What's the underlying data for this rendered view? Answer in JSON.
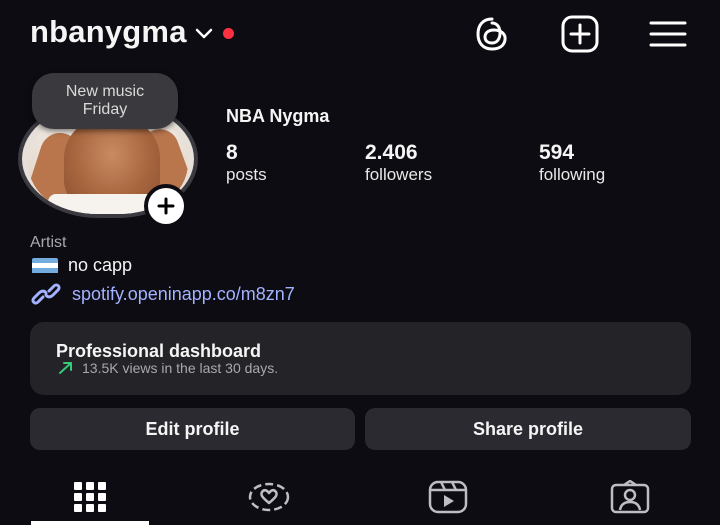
{
  "header": {
    "username": "nbanygma",
    "has_notification_dot": true,
    "icons": [
      "threads-icon",
      "create-post-icon",
      "menu-icon"
    ]
  },
  "note": {
    "line1": "New music",
    "line2": "Friday"
  },
  "profile": {
    "display_name": "NBA Nygma",
    "stats": [
      {
        "value": "8",
        "label": "posts"
      },
      {
        "value": "2.406",
        "label": "followers"
      },
      {
        "value": "594",
        "label": "following"
      }
    ],
    "category": "Artist",
    "bio": "no capp",
    "flag": "argentina-flag-icon",
    "link": "spotify.openinapp.co/m8zn7"
  },
  "dashboard": {
    "title": "Professional dashboard",
    "subtitle": "13.5K views in the last 30 days."
  },
  "actions": {
    "edit": "Edit profile",
    "share": "Share profile"
  },
  "tabs": [
    "grid-icon",
    "reels-hearts-icon",
    "reels-icon",
    "tagged-icon"
  ],
  "colors": {
    "background": "#0c0c12",
    "notification_dot": "#ff3040",
    "link": "#a3b2ff",
    "trend_arrow": "#36c97a",
    "card": "#232328"
  }
}
